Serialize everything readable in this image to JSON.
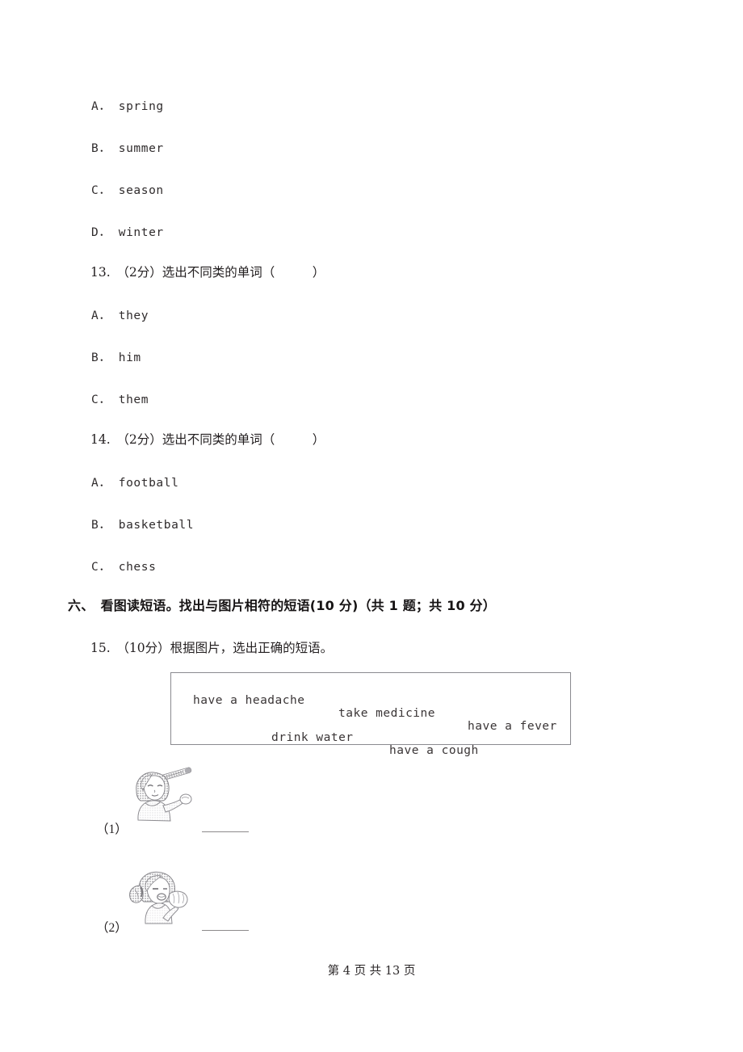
{
  "document": {
    "page_background": "#ffffff",
    "text_color": "#231f20"
  },
  "questions": [
    {
      "id": "q12-options",
      "options": [
        {
          "label": "A． spring"
        },
        {
          "label": "B． summer"
        },
        {
          "label": "C． season"
        },
        {
          "label": "D． winter"
        }
      ]
    },
    {
      "id": "q13",
      "stem": "13.　（2分）选出不同类的单词（　　　）",
      "options": [
        {
          "label": "A． they"
        },
        {
          "label": "B． him"
        },
        {
          "label": "C． them"
        }
      ]
    },
    {
      "id": "q14",
      "stem": "14.　（2分）选出不同类的单词（　　　）",
      "options": [
        {
          "label": "A． football"
        },
        {
          "label": "B． basketball"
        },
        {
          "label": "C． chess"
        }
      ]
    }
  ],
  "section": {
    "heading": "六、　看图读短语。找出与图片相符的短语(10 分)（共 1 题；共 10 分）"
  },
  "question15": {
    "stem": "15.　（10分）根据图片，选出正确的短语。",
    "word_bank": {
      "row1": [
        {
          "text": "have a headache"
        },
        {
          "text": "take medicine"
        },
        {
          "text": "have a fever"
        }
      ],
      "row2": [
        {
          "text": "drink water"
        },
        {
          "text": "have a cough"
        }
      ]
    },
    "items": [
      {
        "label": "（1）",
        "answer": "",
        "art": "child-with-thermometer"
      },
      {
        "label": "（2）",
        "answer": "",
        "art": "girl-coughing"
      }
    ]
  },
  "footer": {
    "text": "第 4 页 共 13 页"
  }
}
